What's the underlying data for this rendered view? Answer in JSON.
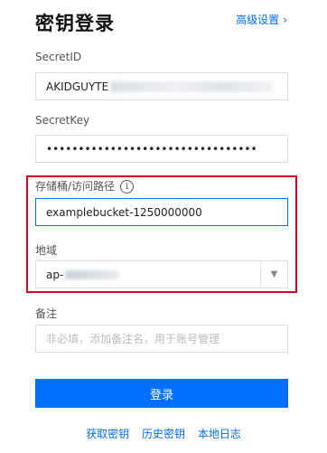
{
  "header": {
    "title": "密钥登录",
    "advanced_link": "高级设置",
    "advanced_chevron": "›"
  },
  "secret_id": {
    "label": "SecretID",
    "value": "AKIDGUYTE"
  },
  "secret_key": {
    "label": "SecretKey",
    "value": "•••••••••••••••••••••••••••••••••"
  },
  "bucket_path": {
    "label": "存储桶/访问路径",
    "info_icon": "i",
    "value": "examplebucket-1250000000"
  },
  "region": {
    "label": "地域",
    "value": "ap-",
    "arrow": "▼"
  },
  "remark": {
    "label": "备注",
    "placeholder": "非必填，添加备注名，用于账号管理"
  },
  "login_button": "登录",
  "footer_links": {
    "get_key": "获取密钥",
    "history_key": "历史密钥",
    "local_log": "本地日志"
  },
  "colors": {
    "accent": "#006eff",
    "highlight_border": "#d9001b"
  }
}
